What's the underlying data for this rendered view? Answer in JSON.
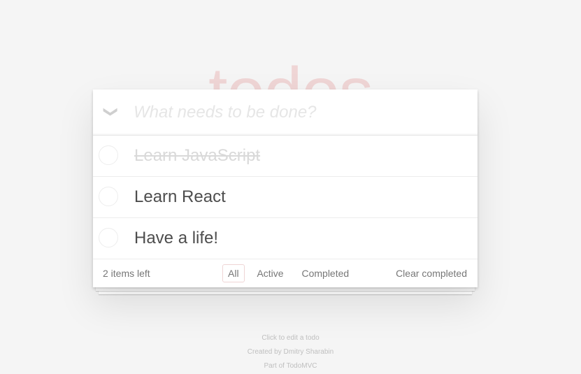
{
  "app": {
    "title": "todos"
  },
  "header": {
    "toggle_all_icon": "chevron-down-icon",
    "toggle_all_glyph": "❯",
    "new_todo_placeholder": "What needs to be done?"
  },
  "todos": [
    {
      "label": "Learn JavaScript",
      "completed": true
    },
    {
      "label": "Learn React",
      "completed": false
    },
    {
      "label": "Have a life!",
      "completed": false
    }
  ],
  "footer": {
    "items_left": "2 items left",
    "filters": [
      {
        "label": "All",
        "selected": true
      },
      {
        "label": "Active",
        "selected": false
      },
      {
        "label": "Completed",
        "selected": false
      }
    ],
    "clear_completed": "Clear completed"
  },
  "info": {
    "edit_hint": "Click to edit a todo",
    "created_by_prefix": "Created by",
    "author": "Dmitry Sharabin",
    "part_of_prefix": "Part of",
    "project": "TodoMVC"
  },
  "colors": {
    "title": "#efd5d5",
    "background": "#f5f5f5",
    "filter_selected_border": "rgba(175,47,47,0.2)"
  }
}
